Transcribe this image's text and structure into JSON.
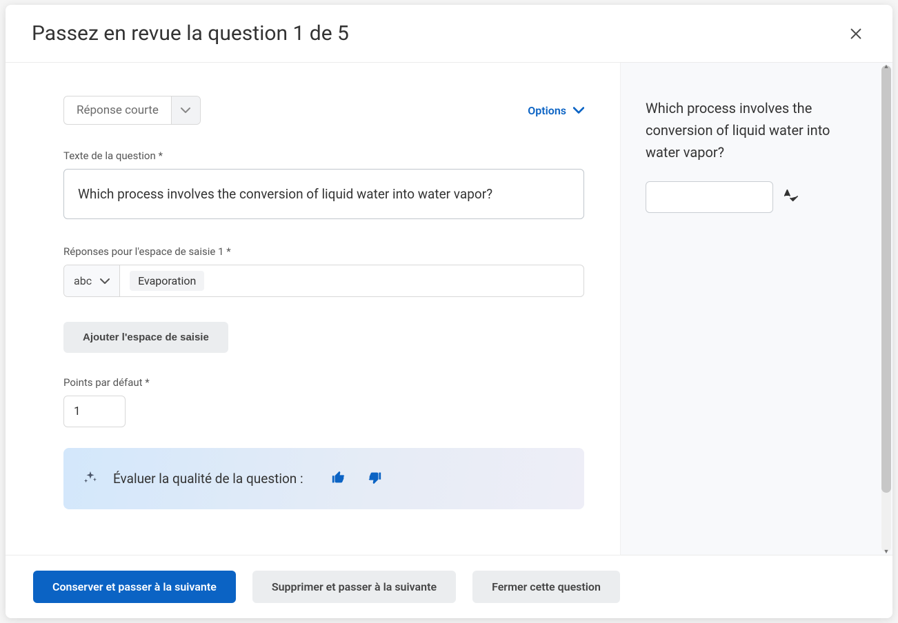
{
  "modal": {
    "title": "Passez en revue la question 1 de 5"
  },
  "form": {
    "question_type": "Réponse courte",
    "options_label": "Options",
    "question_text_label": "Texte de la question *",
    "question_text": "Which process involves the conversion of liquid water into water vapor?",
    "answers_label": "Réponses pour l'espace de saisie 1 *",
    "abc_label": "abc",
    "answer_tag": "Evaporation",
    "add_space_label": "Ajouter l'espace de saisie",
    "points_label": "Points par défaut *",
    "points_value": "1",
    "quality_label": "Évaluer la qualité de la question :"
  },
  "preview": {
    "question_text": "Which process involves the conversion of liquid water into water vapor?"
  },
  "footer": {
    "save_next": "Conserver et passer à la suivante",
    "delete_next": "Supprimer et passer à la suivante",
    "close": "Fermer cette question"
  }
}
